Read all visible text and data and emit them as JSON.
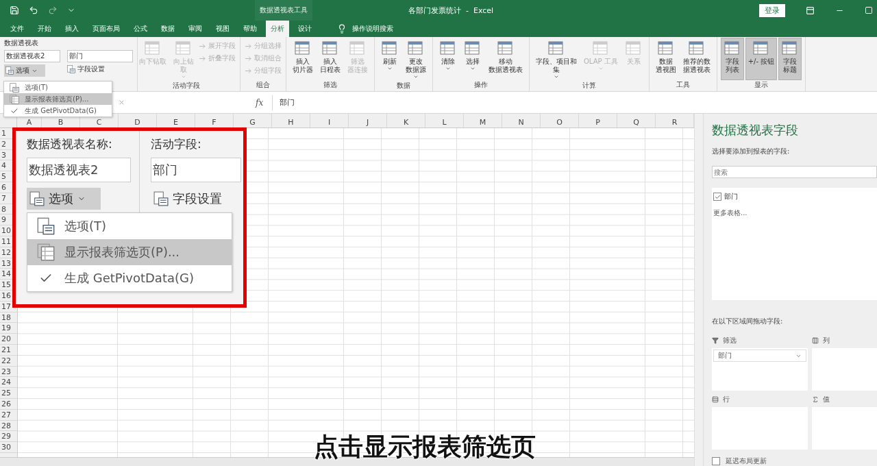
{
  "title_bar": {
    "context_title": "数据透视表工具",
    "document_title": "各部门发票统计  -  Excel",
    "sign_in": "登录"
  },
  "tabs": [
    {
      "label": "文件",
      "selected": false
    },
    {
      "label": "开始",
      "selected": false
    },
    {
      "label": "插入",
      "selected": false
    },
    {
      "label": "页面布局",
      "selected": false
    },
    {
      "label": "公式",
      "selected": false
    },
    {
      "label": "数据",
      "selected": false
    },
    {
      "label": "审阅",
      "selected": false
    },
    {
      "label": "视图",
      "selected": false
    },
    {
      "label": "帮助",
      "selected": false
    },
    {
      "label": "分析",
      "selected": true
    },
    {
      "label": "设计",
      "selected": false
    }
  ],
  "tell_me": "操作说明搜索",
  "pivot_name": {
    "label": "数据透视表",
    "value": "数据透视表2",
    "options_button": "选项"
  },
  "active_field": {
    "value": "部门",
    "settings_button": "字段设置"
  },
  "ribbon_groups": [
    {
      "label": "活动字段",
      "buttons": [
        {
          "kind": "large",
          "lines": [
            "向下钻取"
          ],
          "disabled": true,
          "menu": false,
          "pressed": false
        },
        {
          "kind": "large",
          "lines": [
            "向上钻",
            "取"
          ],
          "disabled": true,
          "menu": true,
          "pressed": false
        },
        {
          "kind": "small",
          "lines": [
            "展开字段"
          ],
          "disabled": true,
          "menu": false,
          "pressed": false
        },
        {
          "kind": "small",
          "lines": [
            "折叠字段"
          ],
          "disabled": true,
          "menu": false,
          "pressed": false
        }
      ]
    },
    {
      "label": "组合",
      "buttons": [
        {
          "kind": "small",
          "lines": [
            "分组选择"
          ],
          "disabled": true,
          "menu": false,
          "pressed": false
        },
        {
          "kind": "small",
          "lines": [
            "取消组合"
          ],
          "disabled": true,
          "menu": false,
          "pressed": false
        },
        {
          "kind": "small",
          "lines": [
            "分组字段"
          ],
          "disabled": true,
          "menu": false,
          "pressed": false
        }
      ]
    },
    {
      "label": "筛选",
      "buttons": [
        {
          "kind": "large",
          "lines": [
            "插入",
            "切片器"
          ],
          "disabled": false,
          "menu": false,
          "pressed": false
        },
        {
          "kind": "large",
          "lines": [
            "插入",
            "日程表"
          ],
          "disabled": false,
          "menu": false,
          "pressed": false
        },
        {
          "kind": "large",
          "lines": [
            "筛选",
            "器连接"
          ],
          "disabled": true,
          "menu": false,
          "pressed": false
        }
      ]
    },
    {
      "label": "数据",
      "buttons": [
        {
          "kind": "large",
          "lines": [
            "刷新"
          ],
          "disabled": false,
          "menu": true,
          "pressed": false
        },
        {
          "kind": "large",
          "lines": [
            "更改",
            "数据源"
          ],
          "disabled": false,
          "menu": true,
          "pressed": false
        }
      ]
    },
    {
      "label": "操作",
      "buttons": [
        {
          "kind": "large",
          "lines": [
            "清除"
          ],
          "disabled": false,
          "menu": true,
          "pressed": false
        },
        {
          "kind": "large",
          "lines": [
            "选择"
          ],
          "disabled": false,
          "menu": true,
          "pressed": false
        },
        {
          "kind": "large",
          "lines": [
            "移动",
            "数据透视表"
          ],
          "disabled": false,
          "menu": false,
          "pressed": false
        }
      ]
    },
    {
      "label": "计算",
      "buttons": [
        {
          "kind": "large",
          "lines": [
            "字段、项目和",
            "集"
          ],
          "disabled": false,
          "menu": true,
          "pressed": false
        },
        {
          "kind": "large",
          "lines": [
            "OLAP 工具"
          ],
          "disabled": true,
          "menu": true,
          "pressed": false
        },
        {
          "kind": "large",
          "lines": [
            "关系"
          ],
          "disabled": true,
          "menu": false,
          "pressed": false
        }
      ]
    },
    {
      "label": "工具",
      "buttons": [
        {
          "kind": "large",
          "lines": [
            "数据",
            "透视图"
          ],
          "disabled": false,
          "menu": false,
          "pressed": false
        },
        {
          "kind": "large",
          "lines": [
            "推荐的数",
            "据透视表"
          ],
          "disabled": false,
          "menu": false,
          "pressed": false
        }
      ]
    },
    {
      "label": "显示",
      "buttons": [
        {
          "kind": "large",
          "lines": [
            "字段",
            "列表"
          ],
          "disabled": false,
          "menu": false,
          "pressed": true
        },
        {
          "kind": "large",
          "lines": [
            "+/- 按钮"
          ],
          "disabled": false,
          "menu": false,
          "pressed": true
        },
        {
          "kind": "large",
          "lines": [
            "字段",
            "标题"
          ],
          "disabled": false,
          "menu": false,
          "pressed": true
        }
      ]
    }
  ],
  "options_menu": [
    {
      "kind": "options",
      "label": "选项(T)",
      "selected": false
    },
    {
      "kind": "pages",
      "label": "显示报表筛选页(P)...",
      "selected": true
    },
    {
      "kind": "toggle",
      "label": "生成 GetPivotData(G)",
      "selected": false,
      "checked": true
    }
  ],
  "formula_bar": {
    "fx": "fx",
    "value": "部门"
  },
  "columns": [
    "A",
    "B",
    "C",
    "D",
    "E",
    "F",
    "G",
    "H",
    "I",
    "J",
    "K",
    "L",
    "M",
    "N",
    "O",
    "P",
    "Q",
    "R"
  ],
  "rows": [
    "1",
    "2",
    "3",
    "4",
    "5",
    "6",
    "7",
    "8",
    "9",
    "10",
    "11",
    "12",
    "13",
    "14",
    "15",
    "16",
    "17",
    "18",
    "19",
    "20",
    "21",
    "22",
    "23",
    "24",
    "25",
    "26",
    "27",
    "28",
    "29",
    "30"
  ],
  "callout": {
    "pivot_name_label": "数据透视表名称:",
    "pivot_name": "数据透视表2",
    "options_button": "选项",
    "active_field_label": "活动字段:",
    "active_field": "部门",
    "settings_button": "字段设置",
    "menu": [
      {
        "kind": "options",
        "label": "选项(T)",
        "selected": false
      },
      {
        "kind": "pages",
        "label": "显示报表筛选页(P)...",
        "selected": true
      },
      {
        "kind": "toggle",
        "label": "生成 GetPivotData(G)",
        "selected": false,
        "checked": true
      }
    ]
  },
  "field_pane": {
    "title": "数据透视表字段",
    "subtitle": "选择要添加到报表的字段:",
    "search_placeholder": "搜索",
    "fields": [
      {
        "label": "部门",
        "checked": true
      }
    ],
    "more_tables": "更多表格...",
    "drag_hint": "在以下区域间拖动字段:",
    "areas": [
      {
        "kind": "filter",
        "label": "筛选",
        "items": [
          "部门"
        ]
      },
      {
        "kind": "columns",
        "label": "列"
      },
      {
        "kind": "rows",
        "label": "行"
      },
      {
        "kind": "values",
        "label": "值"
      }
    ],
    "defer_update": {
      "label": "延迟布局更新",
      "checked": false
    }
  },
  "subtitle": "点击显示报表筛选页"
}
